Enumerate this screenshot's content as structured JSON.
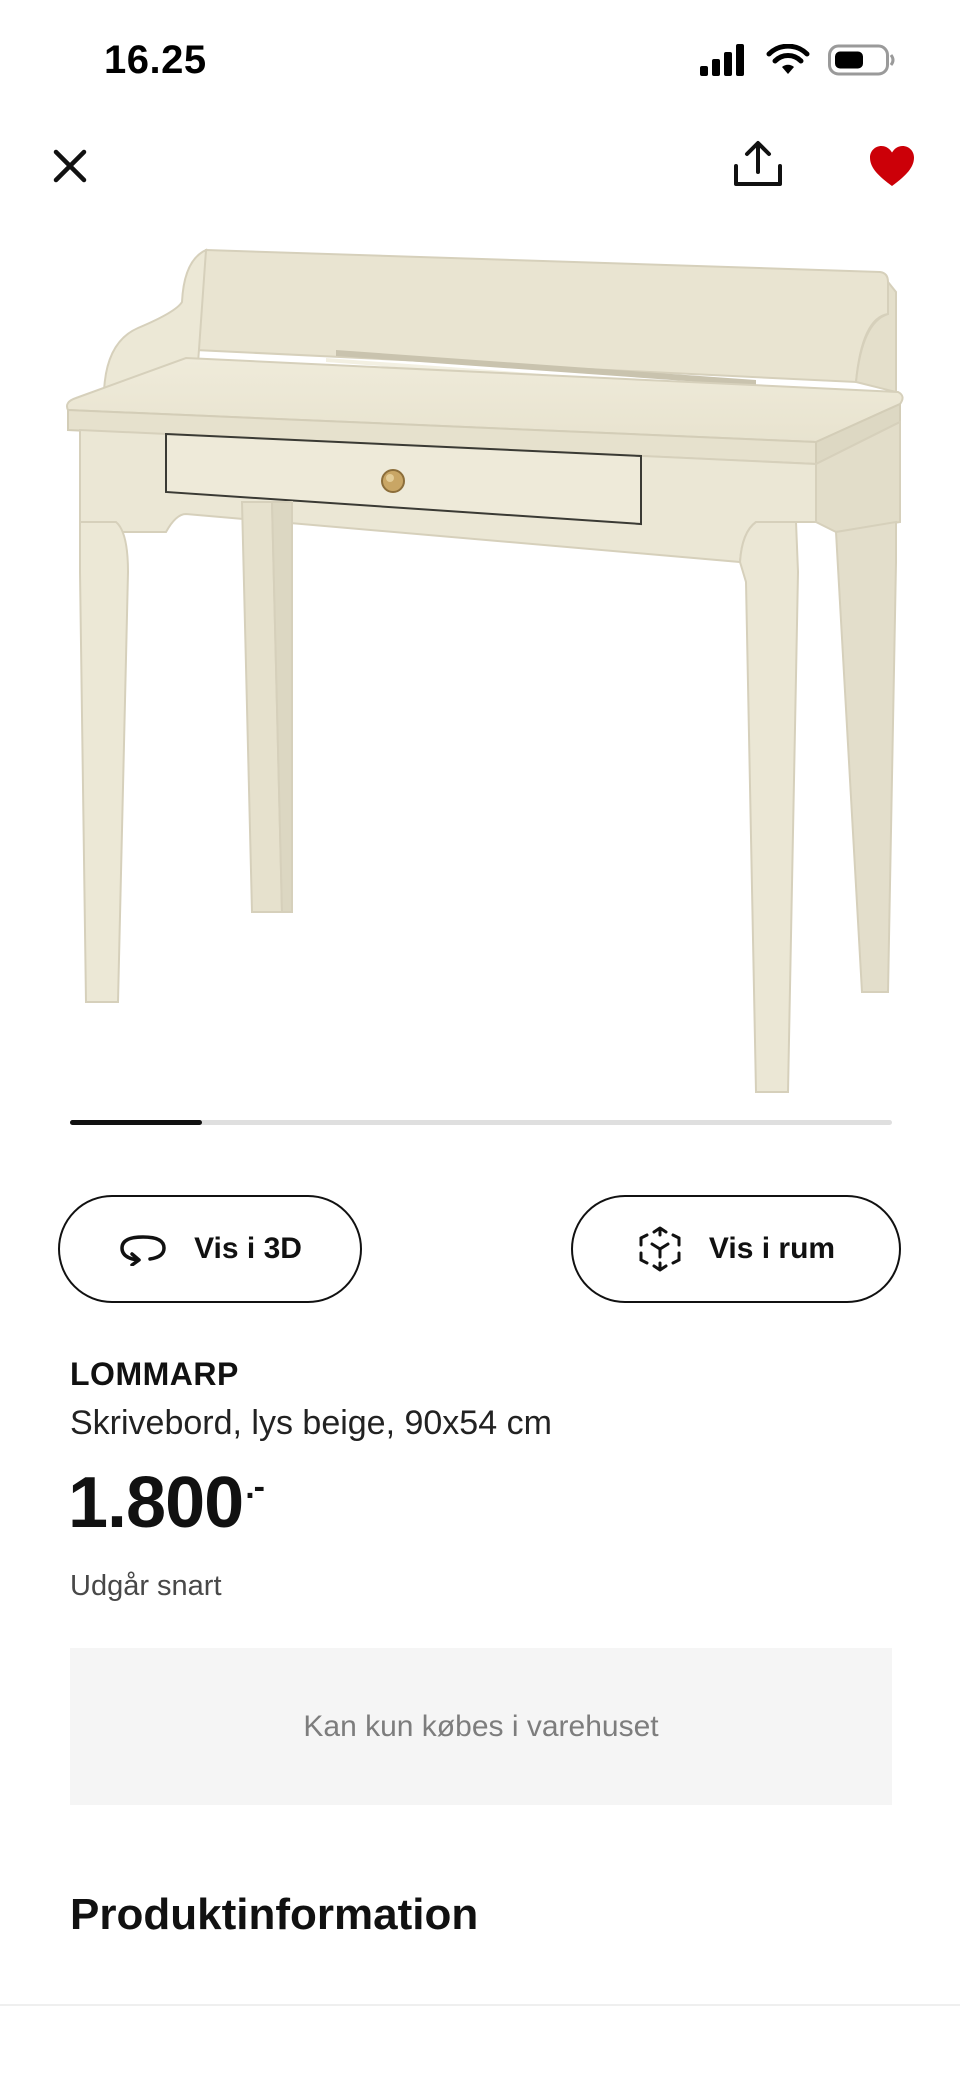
{
  "status_bar": {
    "time": "16.25",
    "icons": [
      "signal-icon",
      "wifi-icon",
      "battery-icon"
    ]
  },
  "top_actions": {
    "icons": [
      "close-icon",
      "share-icon",
      "heart-icon"
    ],
    "favorite_color": "#cc0008"
  },
  "product_image": {
    "description_icon": "desk-image",
    "color": "#eeead8"
  },
  "carousel": {
    "position_fraction": 0.16
  },
  "actions": {
    "view_3d_label": "Vis i 3D",
    "view_room_label": "Vis i rum"
  },
  "product": {
    "name": "LOMMARP",
    "description": "Skrivebord, lys beige, 90x54 cm",
    "price": "1.800",
    "price_suffix": ".-",
    "status": "Udgår snart",
    "notice": "Kan kun købes i varehuset"
  },
  "sections": {
    "product_info_title": "Produktinformation"
  }
}
